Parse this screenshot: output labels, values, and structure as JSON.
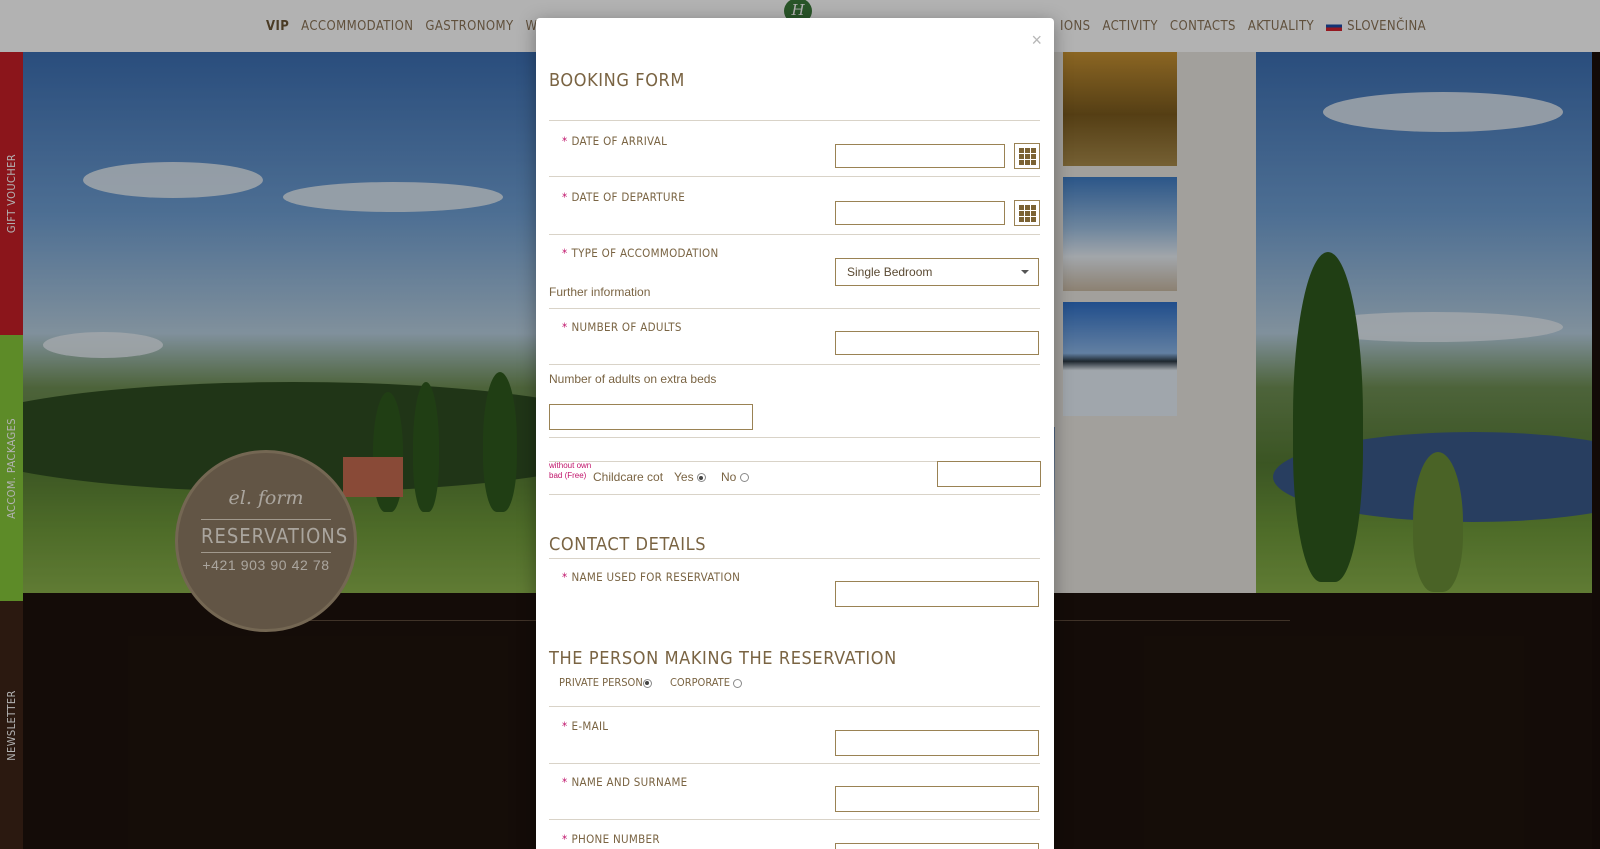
{
  "nav": {
    "left": [
      "VIP",
      "ACCOMMODATION",
      "GASTRONOMY",
      "WELLN"
    ],
    "right": [
      "IONS",
      "ACTIVITY",
      "CONTACTS",
      "AKTUALITY",
      "SLOVENČINA"
    ]
  },
  "logo_letter": "H",
  "side_tabs": {
    "gift": "GIFT VOUCHER",
    "accom": "ACCOM. PACKAGES",
    "news": "NEWSLETTER"
  },
  "badge": {
    "top": "el. form",
    "main": "RESERVATIONS",
    "phone": "+421 903 90 42 78"
  },
  "modal": {
    "close": "×",
    "title": "BOOKING FORM",
    "date_arrival": "DATE OF ARRIVAL",
    "date_departure": "DATE OF DEPARTURE",
    "type_accommodation": "TYPE OF ACCOMMODATION",
    "accommodation_value": "Single Bedroom",
    "further_info": "Further information",
    "num_adults": "NUMBER OF ADULTS",
    "adults_extra_beds": "Number of adults on extra beds",
    "childcare_note": "without own bad (Free)",
    "childcare_label": "Childcare cot",
    "yes": "Yes",
    "no": "No",
    "contact_title": "CONTACT DETAILS",
    "name_for_reservation": "NAME USED FOR RESERVATION",
    "person_title": "THE PERSON MAKING THE RESERVATION",
    "private_person": "PRIVATE PERSON",
    "corporate": "CORPORATE",
    "email": "E-MAIL",
    "name_surname": "NAME AND SURNAME",
    "phone": "PHONE NUMBER",
    "required_mark": "*"
  }
}
